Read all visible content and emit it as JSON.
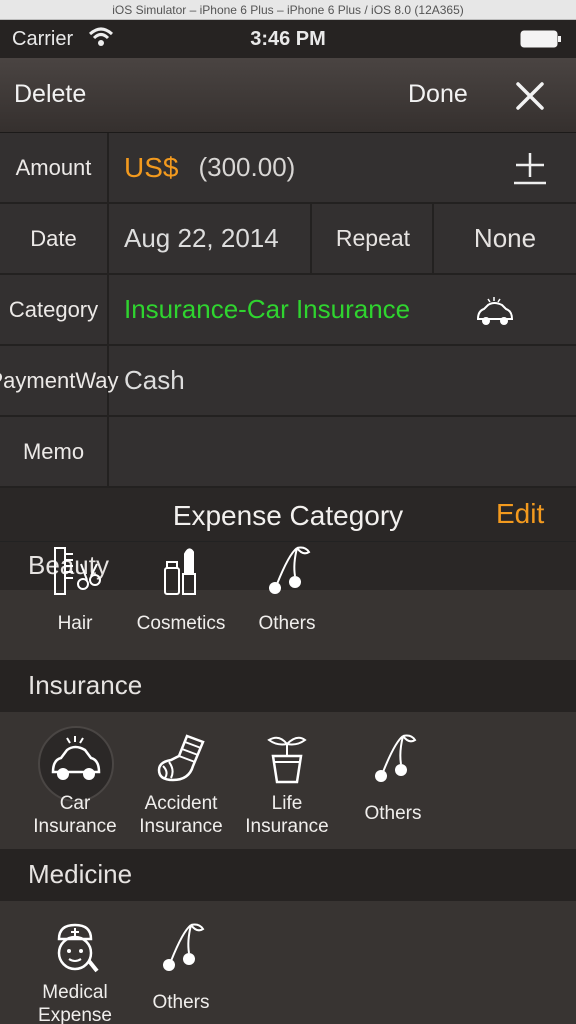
{
  "simulator_title": "iOS Simulator – iPhone 6 Plus – iPhone 6 Plus / iOS 8.0 (12A365)",
  "status_bar": {
    "carrier": "Carrier",
    "time": "3:46 PM"
  },
  "navbar": {
    "delete_label": "Delete",
    "done_label": "Done",
    "close_icon": "close-icon"
  },
  "form": {
    "amount": {
      "label": "Amount",
      "currency": "US$",
      "value": "(300.00)"
    },
    "date": {
      "label": "Date",
      "value": "Aug 22, 2014",
      "repeat_label": "Repeat",
      "repeat_value": "None"
    },
    "category": {
      "label": "Category",
      "value": "Insurance-Car Insurance",
      "icon": "car-icon"
    },
    "payment": {
      "label_line1": "Payment",
      "label_line2": "Way",
      "value": "Cash"
    },
    "memo": {
      "label": "Memo",
      "value": ""
    }
  },
  "panel": {
    "title": "Expense Category",
    "edit_label": "Edit"
  },
  "sections": {
    "beauty": {
      "name": "Beauty",
      "items": [
        {
          "label": "Hair",
          "icon": "comb-scissors-icon"
        },
        {
          "label": "Cosmetics",
          "icon": "lipstick-icon"
        },
        {
          "label": "Others",
          "icon": "cherries-icon"
        }
      ]
    },
    "insurance": {
      "name": "Insurance",
      "items": [
        {
          "label1": "Car",
          "label2": "Insurance",
          "icon": "car-icon",
          "selected": true
        },
        {
          "label1": "Accident",
          "label2": "Insurance",
          "icon": "sock-icon"
        },
        {
          "label1": "Life",
          "label2": "Insurance",
          "icon": "plant-pot-icon"
        },
        {
          "label": "Others",
          "icon": "cherries-icon"
        }
      ]
    },
    "medicine": {
      "name": "Medicine",
      "items": [
        {
          "label1": "Medical",
          "label2": "Expense",
          "icon": "nurse-icon"
        },
        {
          "label": "Others",
          "icon": "cherries-icon"
        }
      ]
    }
  },
  "colors": {
    "accent_orange": "#f39a1e",
    "category_green": "#2fd42f",
    "background": "#2a2726"
  }
}
